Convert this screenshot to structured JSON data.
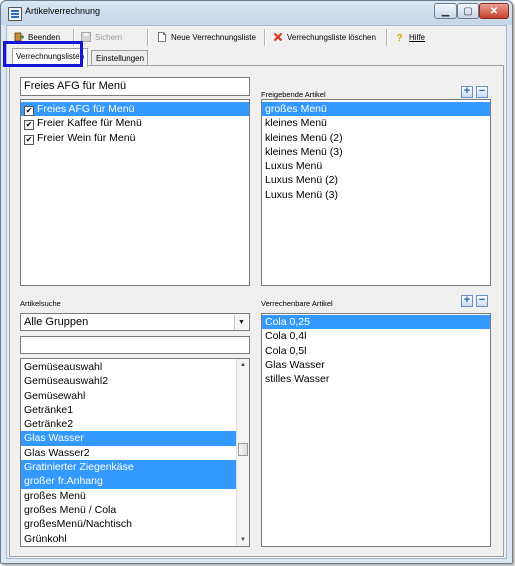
{
  "window": {
    "title": "Artikelverrechnung"
  },
  "toolbar": {
    "beenden": "Beenden",
    "sichern": "Sichern",
    "neue_liste": "Neue Verrechnungsliste",
    "liste_loeschen": "Verrechungsliste löschen",
    "hilfe": "Hilfe"
  },
  "tabs": {
    "verrechnungslisten": "Verrechnungslisten",
    "einstellungen": "Einstellungen"
  },
  "list_name_field": {
    "value": "Freies AFG für Menü"
  },
  "verrechnungslisten": [
    {
      "label": "Freies AFG für Menü",
      "checked": true,
      "selected": true
    },
    {
      "label": "Freier Kaffee für Menü",
      "checked": true,
      "selected": false
    },
    {
      "label": "Freier Wein für Menü",
      "checked": true,
      "selected": false
    }
  ],
  "freigebende": {
    "label": "Freigebende Artikel",
    "items": [
      "großes Menü",
      "kleines Menü",
      "kleines Menü (2)",
      "kleines Menü (3)",
      "Luxus Menü",
      "Luxus Menü (2)",
      "Luxus Menü (3)"
    ],
    "selected_index": 0
  },
  "artikelsuche": {
    "label": "Artikelsuche",
    "group_value": "Alle Gruppen",
    "search_value": "",
    "items": [
      "Gemüseauswahl",
      "Gemüseauswahl2",
      "Gemüsewahl",
      "Getränke1",
      "Getränke2",
      "Glas Wasser",
      "Glas Wasser2",
      "Gratinierter Ziegenkäse",
      "großer fr.Anhang",
      "großes Menü",
      "großes Menü / Cola",
      "großesMenü/Nachtisch",
      "Grünkohl"
    ],
    "selected_indices": [
      5,
      7,
      8
    ]
  },
  "verrechenbare": {
    "label": "Verrechenbare Artikel",
    "items": [
      "Cola 0,25",
      "Cola 0,4l",
      "Cola 0,5l",
      "Glas Wasser",
      "stilles Wasser"
    ],
    "selected_index": 0
  },
  "colors": {
    "selection": "#3399ff",
    "highlight_frame": "#1515d8"
  }
}
